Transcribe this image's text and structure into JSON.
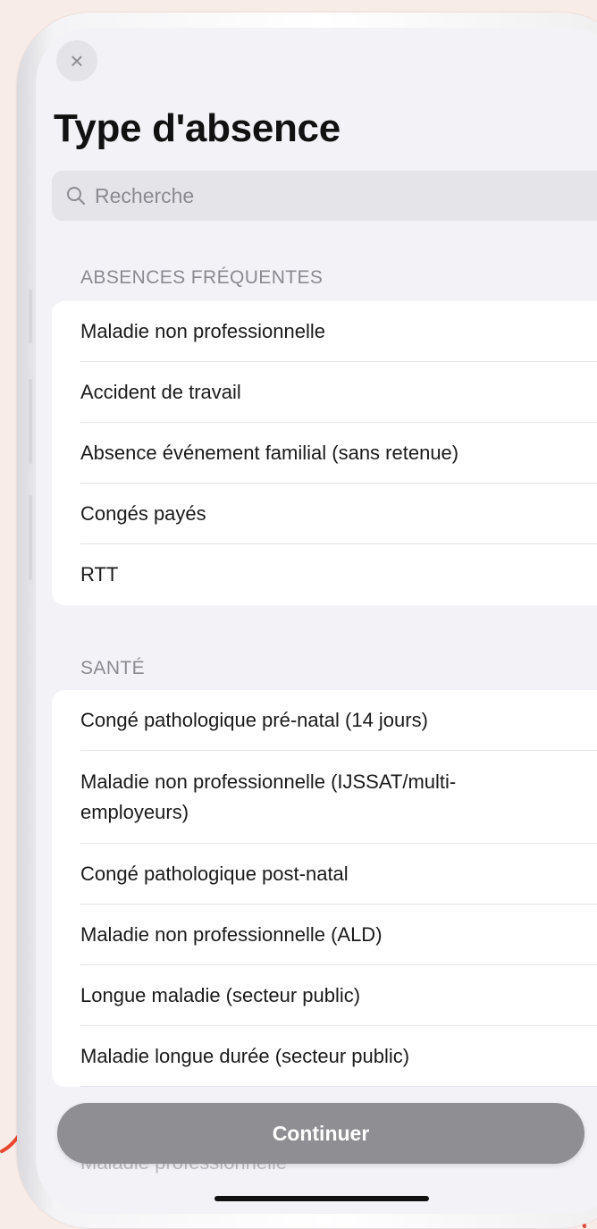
{
  "screen": {
    "title": "Type d'absence",
    "close_icon": "close-icon",
    "search": {
      "placeholder": "Recherche",
      "icon": "search-icon"
    }
  },
  "sections": [
    {
      "header": "ABSENCES FRÉQUENTES",
      "items": [
        "Maladie non professionnelle",
        "Accident de travail",
        "Absence événement familial (sans retenue)",
        "Congés payés",
        "RTT"
      ]
    },
    {
      "header": "SANTÉ",
      "items": [
        "Congé pathologique pré-natal (14 jours)",
        "Maladie non professionnelle (IJSSAT/multi-employeurs)",
        "Congé pathologique post-natal",
        "Maladie non professionnelle (ALD)",
        "Longue maladie (secteur public)",
        "Maladie longue durée (secteur public)",
        "Maladie professionnelle"
      ]
    }
  ],
  "continue_button": {
    "label": "Continuer"
  },
  "colors": {
    "background": "#f8ece8",
    "screen": "#f2f2f7",
    "button": "#8e8e93",
    "accent_decor": "#e8472f"
  }
}
